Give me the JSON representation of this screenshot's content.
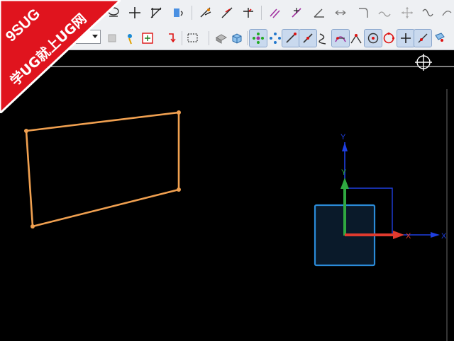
{
  "toolbar": {
    "snap_mode_value": "",
    "row1_icons": [
      "sketch-icon",
      "point-icon",
      "line-icon",
      "trim-icon",
      "fillet-icon",
      "dimension-icon",
      "angle-dim-icon",
      "perpendicular-dim-icon",
      "parallel-icon",
      "constraint-icon",
      "angle-icon",
      "horizontal-icon",
      "curve-icon",
      "arc-icon",
      "vertex-icon",
      "spline-icon"
    ],
    "row2_icons": [
      "snap-icon",
      "point-on-curve-icon",
      "rotate-icon",
      "select-box-icon",
      "face-icon",
      "box-icon",
      "snap-grid-icon",
      "snap-points-icon",
      "endpoint-icon",
      "midpoint-icon",
      "control-point-icon",
      "intersection-icon",
      "tangent-icon",
      "center-icon",
      "quadrant-icon",
      "existing-point-icon",
      "point-on-line-icon",
      "face-select-icon"
    ]
  },
  "watermark": {
    "line1": "9SUG",
    "line2": "学UG就上UG网",
    "color": "#e0141e"
  },
  "scene": {
    "sketch_color": "#f0a050",
    "csys_color": "#2b8bd8",
    "x_axis_label": "X",
    "y_axis_label": "Y",
    "local_x_label": "X",
    "local_y_label": "Y"
  }
}
